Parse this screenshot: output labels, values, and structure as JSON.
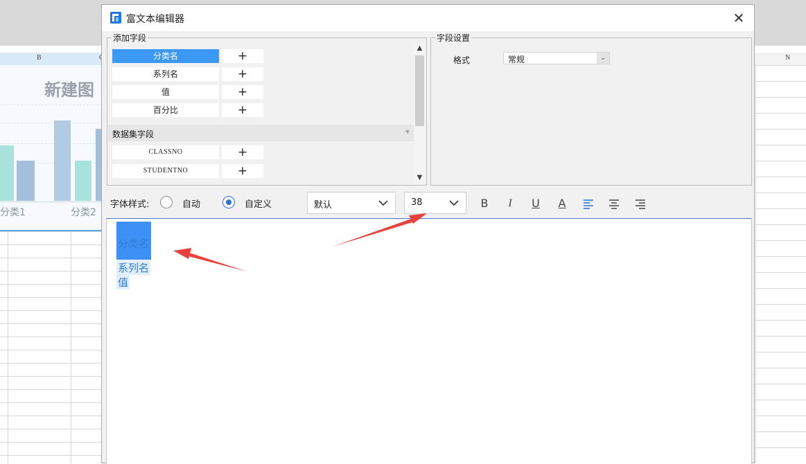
{
  "background": {
    "column_labels": [
      "B",
      "C",
      "N"
    ],
    "chart": {
      "title": "新建图",
      "x_labels": [
        "分类1",
        "分类2"
      ]
    }
  },
  "dialog": {
    "title": "富文本编辑器",
    "close_symbol": "✕",
    "add_fields": {
      "legend": "添加字段",
      "fields": [
        {
          "name": "分类名",
          "selected": true
        },
        {
          "name": "系列名",
          "selected": false
        },
        {
          "name": "值",
          "selected": false
        },
        {
          "name": "百分比",
          "selected": false
        }
      ],
      "dataset_section_title": "数据集字段",
      "dataset_fields": [
        "CLASSNO",
        "STUDENTNO"
      ],
      "add_symbol": "+"
    },
    "field_settings": {
      "legend": "字段设置",
      "format_label": "格式",
      "format_value": "常规"
    },
    "font_style": {
      "label": "字体样式:",
      "options": [
        {
          "label": "自动",
          "checked": false
        },
        {
          "label": "自定义",
          "checked": true
        }
      ],
      "font_family": "默认",
      "font_size": "38",
      "bold_symbol": "B",
      "italic_symbol": "I",
      "underline_symbol": "U",
      "color_symbol": "A"
    },
    "editor": {
      "lines": [
        "分类名",
        "系列名",
        "值"
      ]
    }
  },
  "colors": {
    "accent": "#3c98f5",
    "annotation_arrow": "#e8403a",
    "editor_text": "#2f7fd8"
  }
}
